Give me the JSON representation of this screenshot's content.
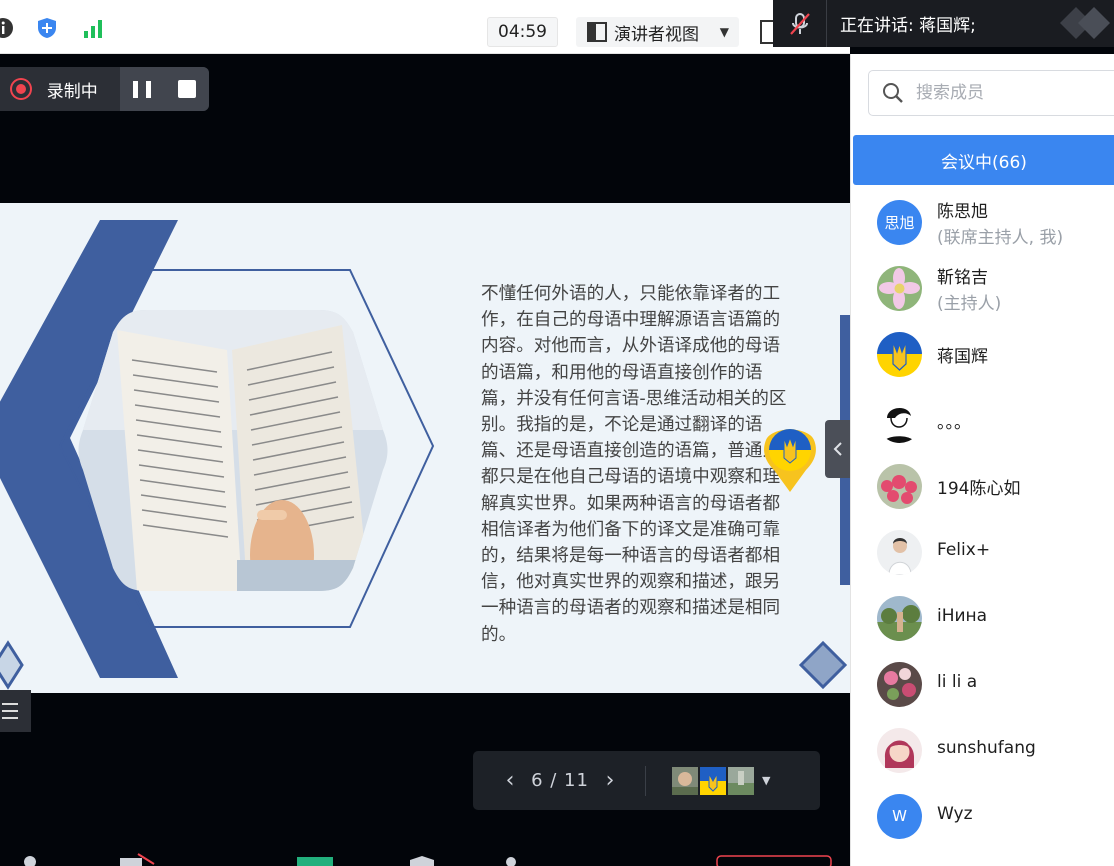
{
  "toolbar": {
    "timer": "04:59",
    "view_label": "演讲者视图"
  },
  "speaking": {
    "text": "正在讲话: 蒋国辉;"
  },
  "recording": {
    "label": "录制中"
  },
  "slide": {
    "paragraph": "不懂任何外语的人，只能依靠译者的工作，在自己的母语中理解源语言语篇的内容。对他而言，从外语译成他的母语的语篇，和用他的母语直接创作的语篇，并没有任何言语-思维活动相关的区别。我指的是，不论是通过翻译的语篇、还是母语直接创造的语篇，普通人都只是在他自己母语的语境中观察和理解真实世界。如果两种语言的母语者都相信译者为他们备下的译文是准确可靠的，结果将是每一种语言的母语者都相信，他对真实世界的观察和描述，跟另一种语言的母语者的观察和描述是相同的。"
  },
  "pager": {
    "page": "6 / 11",
    "current_page": 6,
    "total_pages": 11
  },
  "panel": {
    "search_placeholder": "搜索成员",
    "tab_label": "会议中(66)",
    "members": [
      {
        "name": "陈思旭",
        "role": "(联席主持人, 我)",
        "avatar_text": "思旭",
        "avatar_color": "#3a86f0"
      },
      {
        "name": "靳铭吉",
        "role": "(主持人)"
      },
      {
        "name": "蒋国辉",
        "role": ""
      },
      {
        "name": "。。。",
        "role": ""
      },
      {
        "name": "194陈心如",
        "role": ""
      },
      {
        "name": "Felix+",
        "role": ""
      },
      {
        "name": "iНина",
        "role": ""
      },
      {
        "name": "li li a",
        "role": ""
      },
      {
        "name": "sunshufang",
        "role": ""
      },
      {
        "name": "Wyz",
        "role": "",
        "avatar_text": "W",
        "avatar_color": "#3a86f0"
      }
    ]
  },
  "colors": {
    "accent": "#3a86f0",
    "record": "#f0444f",
    "slide_navy": "#3f5f9f"
  }
}
